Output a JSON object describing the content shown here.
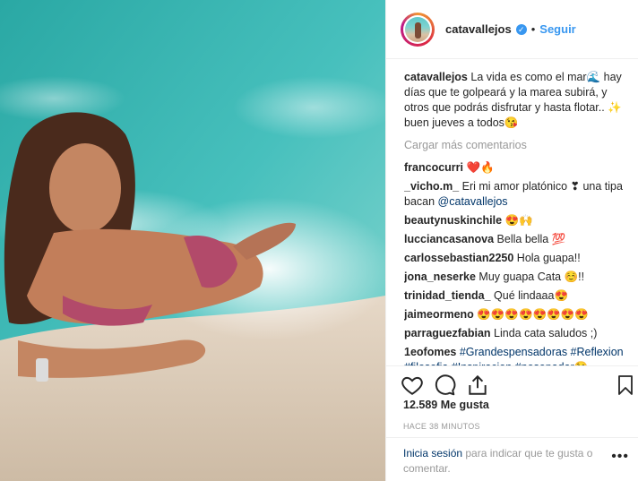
{
  "post": {
    "username": "catavallejos",
    "follow_label": "Seguir",
    "dot": "•",
    "verified_glyph": "✓"
  },
  "caption": {
    "username": "catavallejos",
    "text": "La vida es como el mar🌊 hay días que te golpeará y la marea subirá, y otros que podrás disfrutar y hasta flotar.. ✨ buen jueves a todos😘"
  },
  "load_more_label": "Cargar más comentarios",
  "comments": [
    {
      "user": "francocurri",
      "text": "❤️🔥"
    },
    {
      "user": "_vicho.m_",
      "text": "Eri mi amor platónico ❣ una tipa bacan",
      "mention": "@catavallejos"
    },
    {
      "user": "beautynuskinchile",
      "text": "😍🙌"
    },
    {
      "user": "lucciancasanova",
      "text": "Bella bella 💯"
    },
    {
      "user": "carlossebastian2250",
      "text": "Hola guapa!!"
    },
    {
      "user": "jona_neserke",
      "text": "Muy guapa Cata ☺️!!"
    },
    {
      "user": "trinidad_tienda_",
      "text": "Qué lindaaa😍"
    },
    {
      "user": "jaimeormeno",
      "text": "😍😍😍😍😍😍😍😍"
    },
    {
      "user": "parraguezfabian",
      "text": "Linda cata saludos ;)"
    },
    {
      "user": "1eofomes",
      "text": "",
      "hashtags": "#Grandespensadoras #Reflexion #filosofia #Inspiracion #nosepadar😘"
    }
  ],
  "likes_label": "12.589 Me gusta",
  "timestamp": "HACE 38 MINUTOS",
  "login": {
    "link": "Inicia sesión",
    "text": " para indicar que te gusta o comentar."
  },
  "more_label": "•••",
  "icons": {
    "like": "heart-icon",
    "comment": "comment-icon",
    "share": "share-icon",
    "save": "bookmark-icon"
  },
  "colors": {
    "accent": "#3897f0",
    "link": "#003569",
    "muted": "#999999"
  }
}
